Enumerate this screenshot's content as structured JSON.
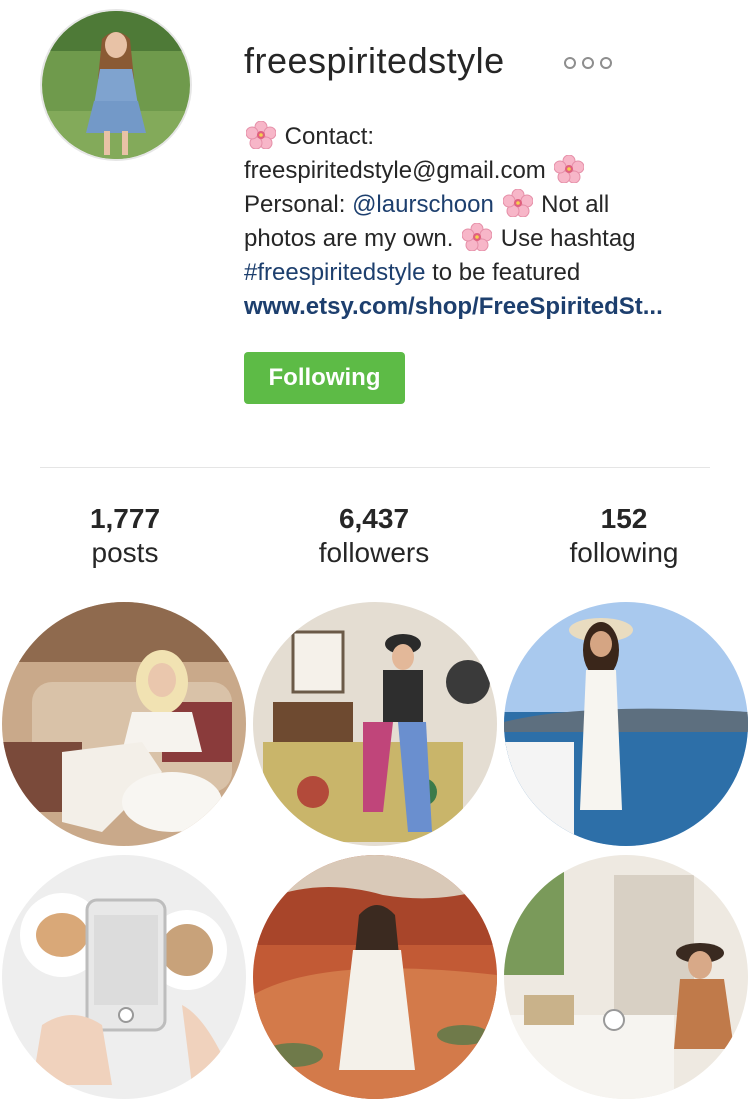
{
  "profile": {
    "username": "freespiritedstyle",
    "more_icon": "ellipsis-icon",
    "bio": {
      "line1": "Contact:",
      "line2": "freespiritedstyle@gmail.com",
      "line3_prefix": "Personal: ",
      "line3_mention": "@laurschoon",
      "line3_suffix": " Not all",
      "line4_prefix": "photos are my own. ",
      "line4_suffix": " Use hashtag",
      "line5_hashtag": "#freespiritedstyle",
      "line5_suffix": " to be featured",
      "website": "www.etsy.com/shop/FreeSpiritedSt..."
    },
    "emoji_icon": "cherry-blossom-icon",
    "follow_button_label": "Following",
    "colors": {
      "follow_button": "#5dbb46",
      "link": "#1d3f6e"
    }
  },
  "stats": [
    {
      "value": "1,777",
      "label": "posts"
    },
    {
      "value": "6,437",
      "label": "followers"
    },
    {
      "value": "152",
      "label": "following"
    }
  ],
  "posts": [
    {
      "subject": "woman-on-sofa-white-crochet"
    },
    {
      "subject": "woman-sitting-on-painted-cabinet"
    },
    {
      "subject": "woman-white-dress-seaside"
    },
    {
      "subject": "phone-photo-of-breakfast"
    },
    {
      "subject": "woman-red-rock-desert"
    },
    {
      "subject": "woman-with-hat-at-breakfast-table"
    }
  ]
}
